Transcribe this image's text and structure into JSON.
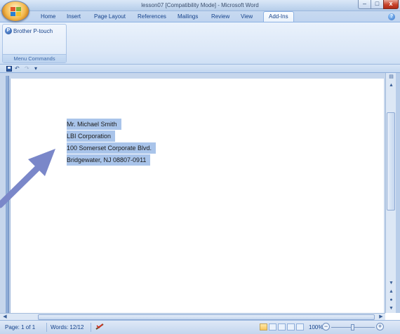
{
  "window": {
    "title": "lesson07 [Compatibility Mode] - Microsoft Word",
    "minimize": "–",
    "maximize": "□",
    "close": "x"
  },
  "ribbon": {
    "tabs": [
      "Home",
      "Insert",
      "Page Layout",
      "References",
      "Mailings",
      "Review",
      "View",
      "Add-Ins"
    ],
    "active_tab": "Add-Ins",
    "group": {
      "button_label": "Brother P-touch",
      "label": "Menu Commands"
    }
  },
  "quick_access": {
    "undo": "↶",
    "redo": "↷",
    "customize": "▾"
  },
  "document": {
    "address_lines": [
      "Mr. Michael Smith",
      "LBI Corporation",
      "100 Somerset Corporate Blvd.",
      "Bridgewater, NJ   08807-0911"
    ]
  },
  "status_bar": {
    "page": "Page: 1 of 1",
    "words": "Words: 12/12",
    "zoom": "100%",
    "zoom_out": "−",
    "zoom_in": "+"
  },
  "colors": {
    "selection": "#a9c4ea",
    "ribbon": "#dbe7f7",
    "annotation_arrow": "#7a87c9"
  }
}
